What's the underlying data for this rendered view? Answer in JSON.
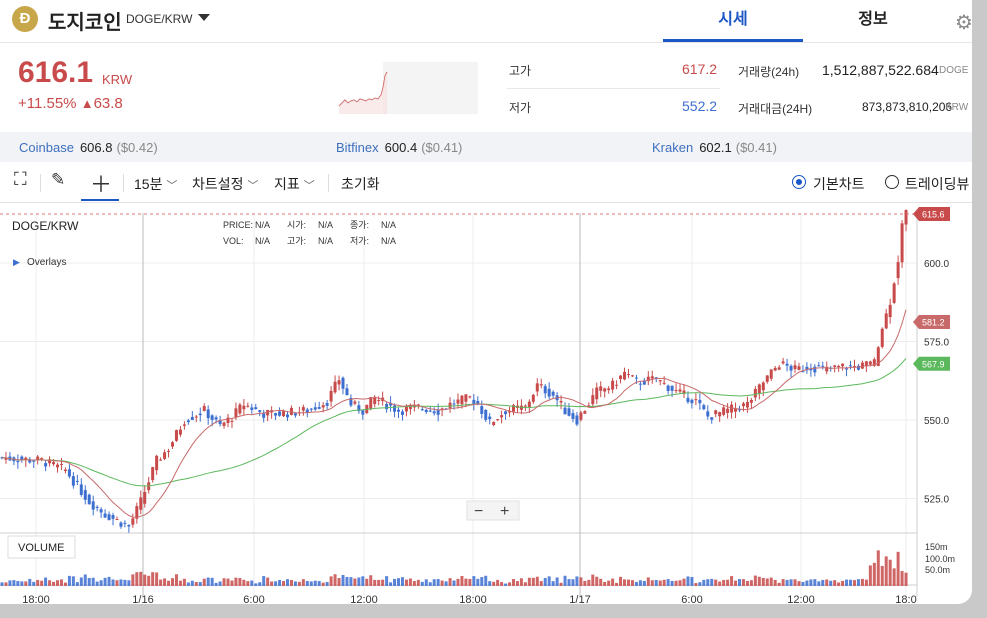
{
  "header": {
    "coin_symbol_glyph": "Ð",
    "coin_name": "도지코인",
    "pair": "DOGE/KRW",
    "tabs": [
      {
        "label": "시세",
        "active": true
      },
      {
        "label": "정보",
        "active": false
      }
    ]
  },
  "summary": {
    "price": "616.1",
    "currency": "KRW",
    "change_pct": "+11.55%",
    "change_arrow": "▲",
    "change_abs": "63.8",
    "high_label": "고가",
    "high_value": "617.2",
    "low_label": "저가",
    "low_value": "552.2",
    "volume_label": "거래량(24h)",
    "volume_value": "1,512,887,522.684",
    "volume_unit": "DOGE",
    "turnover_label": "거래대금(24H)",
    "turnover_value": "873,873,810,206",
    "turnover_unit": "KRW"
  },
  "exchanges": [
    {
      "name": "Coinbase",
      "price": "606.8",
      "usd": "($0.42)"
    },
    {
      "name": "Bitfinex",
      "price": "600.4",
      "usd": "($0.41)"
    },
    {
      "name": "Kraken",
      "price": "602.1",
      "usd": "($0.41)"
    }
  ],
  "toolbar": {
    "interval": "15분",
    "settings": "차트설정",
    "indicators": "지표",
    "reset": "초기화",
    "mode_basic": "기본차트",
    "mode_tv": "트레이딩뷰"
  },
  "chart_data": {
    "type": "candlestick",
    "symbol_label": "DOGE/KRW",
    "overlays_label": "Overlays",
    "legend": {
      "price_label": "PRICE:",
      "price_value": "N/A",
      "open_label": "시가:",
      "open_value": "N/A",
      "close_label": "종가:",
      "close_value": "N/A",
      "vol_label": "VOL:",
      "vol_value": "N/A",
      "high_label": "고가:",
      "high_value": "N/A",
      "low_label": "저가:",
      "low_value": "N/A"
    },
    "y_ticks": [
      "600.0",
      "575.0",
      "550.0",
      "525.0"
    ],
    "y_tick_values": [
      600,
      575,
      550,
      525
    ],
    "x_ticks": [
      "18:00",
      "1/16",
      "6:00",
      "12:00",
      "18:00",
      "1/17",
      "6:00",
      "12:00",
      "18:0"
    ],
    "ylim": [
      515,
      620
    ],
    "last_price_tag": "615.6",
    "ma_short_tag": "581.2",
    "ma_long_tag": "567.9",
    "volume_label": "VOLUME",
    "volume_ticks": [
      "150m",
      "100.0m",
      "50.0m"
    ],
    "colors": {
      "up": "#c84a4a",
      "down": "#3d6fd1",
      "ma_short": "#c86a6a",
      "ma_long": "#5cb85c",
      "grid": "#ececec"
    },
    "anchors_close": [
      [
        0,
        538
      ],
      [
        10,
        537
      ],
      [
        16,
        534
      ],
      [
        22,
        524
      ],
      [
        26,
        520
      ],
      [
        32,
        516
      ],
      [
        35,
        524
      ],
      [
        39,
        537
      ],
      [
        42,
        541
      ],
      [
        46,
        550
      ],
      [
        51,
        553
      ],
      [
        55,
        548
      ],
      [
        58,
        551
      ],
      [
        61,
        555
      ],
      [
        66,
        552
      ],
      [
        70,
        552
      ],
      [
        77,
        553
      ],
      [
        82,
        556
      ],
      [
        85,
        563
      ],
      [
        88,
        555
      ],
      [
        91,
        553
      ],
      [
        94,
        557
      ],
      [
        97,
        555
      ],
      [
        100,
        553
      ],
      [
        105,
        554
      ],
      [
        110,
        553
      ],
      [
        113,
        555
      ],
      [
        118,
        557
      ],
      [
        120,
        555
      ],
      [
        123,
        549
      ],
      [
        127,
        553
      ],
      [
        132,
        554
      ],
      [
        135,
        561
      ],
      [
        139,
        558
      ],
      [
        142,
        553
      ],
      [
        145,
        550
      ],
      [
        150,
        559
      ],
      [
        154,
        561
      ],
      [
        157,
        565
      ],
      [
        160,
        562
      ],
      [
        165,
        563
      ],
      [
        170,
        559
      ],
      [
        175,
        556
      ],
      [
        178,
        551
      ],
      [
        183,
        553
      ],
      [
        188,
        555
      ],
      [
        192,
        562
      ],
      [
        196,
        568
      ],
      [
        200,
        566
      ],
      [
        204,
        567
      ],
      [
        208,
        566
      ],
      [
        212,
        567
      ],
      [
        216,
        567
      ],
      [
        220,
        568
      ],
      [
        222,
        579
      ],
      [
        224,
        588
      ],
      [
        226,
        601
      ],
      [
        227,
        612
      ],
      [
        228,
        616
      ]
    ]
  }
}
